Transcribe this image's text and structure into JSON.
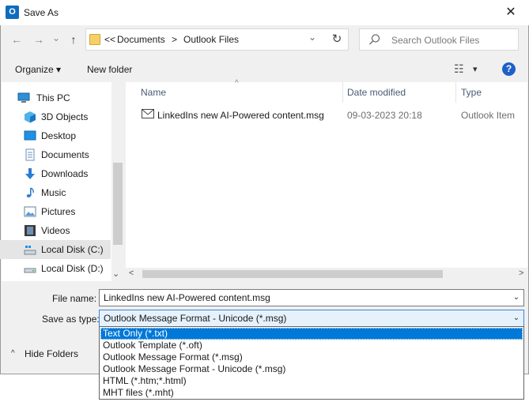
{
  "window": {
    "title": "Save As",
    "app_icon": "outlook-icon",
    "close_glyph": "✕"
  },
  "nav_buttons": {
    "back": "←",
    "forward": "→",
    "recent": "⌄",
    "up": "↑"
  },
  "address": {
    "overflow": "<<",
    "crumbs": [
      "Documents",
      "Outlook Files"
    ],
    "separator": ">",
    "dropdown": "⌄",
    "refresh": "↻"
  },
  "search": {
    "placeholder": "Search Outlook Files"
  },
  "toolbar": {
    "organize": "Organize ▾",
    "new_folder": "New folder",
    "view_glyph": "☷",
    "view_arrow": "▾",
    "help": "?"
  },
  "sidebar": {
    "items": [
      {
        "label": "This PC",
        "icon": "computer-icon"
      },
      {
        "label": "3D Objects",
        "icon": "3d-objects-icon"
      },
      {
        "label": "Desktop",
        "icon": "desktop-icon"
      },
      {
        "label": "Documents",
        "icon": "documents-icon"
      },
      {
        "label": "Downloads",
        "icon": "downloads-icon"
      },
      {
        "label": "Music",
        "icon": "music-icon"
      },
      {
        "label": "Pictures",
        "icon": "pictures-icon"
      },
      {
        "label": "Videos",
        "icon": "videos-icon"
      },
      {
        "label": "Local Disk (C:)",
        "icon": "drive-icon",
        "selected": true
      },
      {
        "label": "Local Disk (D:)",
        "icon": "drive-icon"
      }
    ],
    "scroll_down": "⌄"
  },
  "file_list": {
    "columns": {
      "name": "Name",
      "date": "Date modified",
      "type": "Type"
    },
    "sort_arrow": "^",
    "rows": [
      {
        "name": "LinkedIns new AI-Powered content.msg",
        "date": "09-03-2023 20:18",
        "type": "Outlook Item",
        "icon": "mail-icon"
      }
    ],
    "scroll_left": "<",
    "scroll_right": ">"
  },
  "form": {
    "file_name_label": "File name:",
    "file_name_value": "LinkedIns new AI-Powered content.msg",
    "save_type_label": "Save as type:",
    "save_type_value": "Outlook Message Format - Unicode (*.msg)",
    "dropdown_glyph": "⌄"
  },
  "type_options": [
    {
      "label": "Text Only (*.txt)",
      "selected": true
    },
    {
      "label": "Outlook Template (*.oft)"
    },
    {
      "label": "Outlook Message Format (*.msg)"
    },
    {
      "label": "Outlook Message Format - Unicode (*.msg)"
    },
    {
      "label": "HTML (*.htm;*.html)"
    },
    {
      "label": "MHT files (*.mht)"
    }
  ],
  "footer": {
    "hide_folders": "Hide Folders",
    "hide_folders_glyph": "^"
  },
  "colors": {
    "accent": "#0078d7",
    "selection": "#e5f1fb",
    "help": "#1f5fc7"
  }
}
